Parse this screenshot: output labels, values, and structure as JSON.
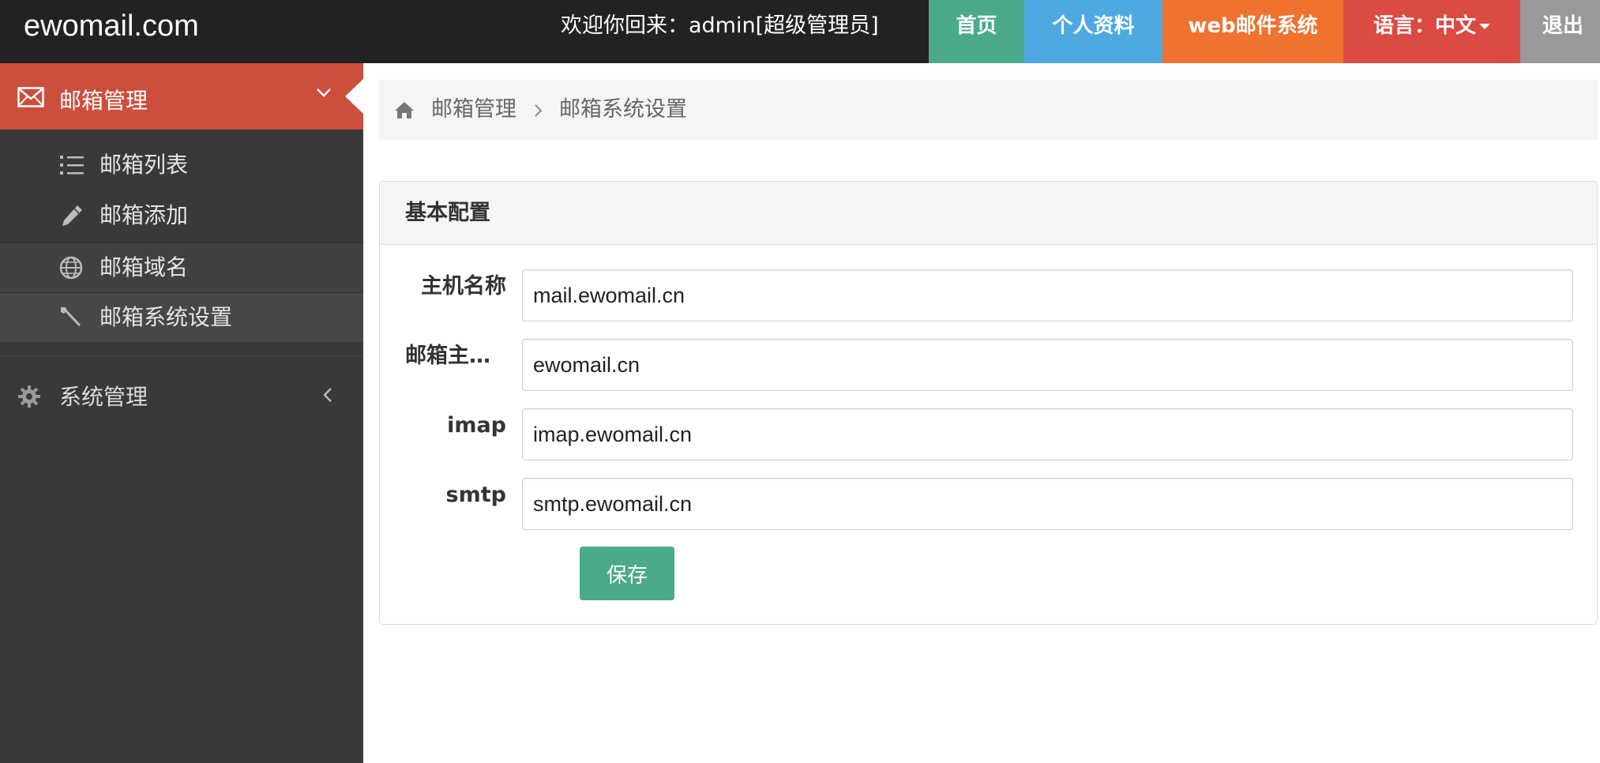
{
  "brand": "ewomail.com",
  "welcome": "欢迎你回来：admin[超级管理员]",
  "nav": {
    "home": "首页",
    "profile": "个人资料",
    "webmail": "web邮件系统",
    "language": "语言：中文",
    "logout": "退出"
  },
  "colors": {
    "home": "#4aaa8a",
    "profile": "#4fa9e1",
    "webmail": "#ef722e",
    "language": "#dc4a44",
    "logout": "#999999",
    "sidebar_active": "#cc4e3c"
  },
  "sidebar": {
    "mailbox_group": "邮箱管理",
    "items": [
      {
        "label": "邮箱列表",
        "icon": "list-icon"
      },
      {
        "label": "邮箱添加",
        "icon": "pencil-icon"
      },
      {
        "label": "邮箱域名",
        "icon": "globe-icon"
      },
      {
        "label": "邮箱系统设置",
        "icon": "wrench-icon"
      }
    ],
    "system_group": "系统管理"
  },
  "breadcrumb": {
    "first": "邮箱管理",
    "current": "邮箱系统设置"
  },
  "panel": {
    "title": "基本配置",
    "fields": [
      {
        "label": "主机名称",
        "value": "mail.ewomail.cn"
      },
      {
        "label": "邮箱主…",
        "value": "ewomail.cn"
      },
      {
        "label": "imap",
        "value": "imap.ewomail.cn"
      },
      {
        "label": "smtp",
        "value": "smtp.ewomail.cn"
      }
    ],
    "save": "保存"
  }
}
